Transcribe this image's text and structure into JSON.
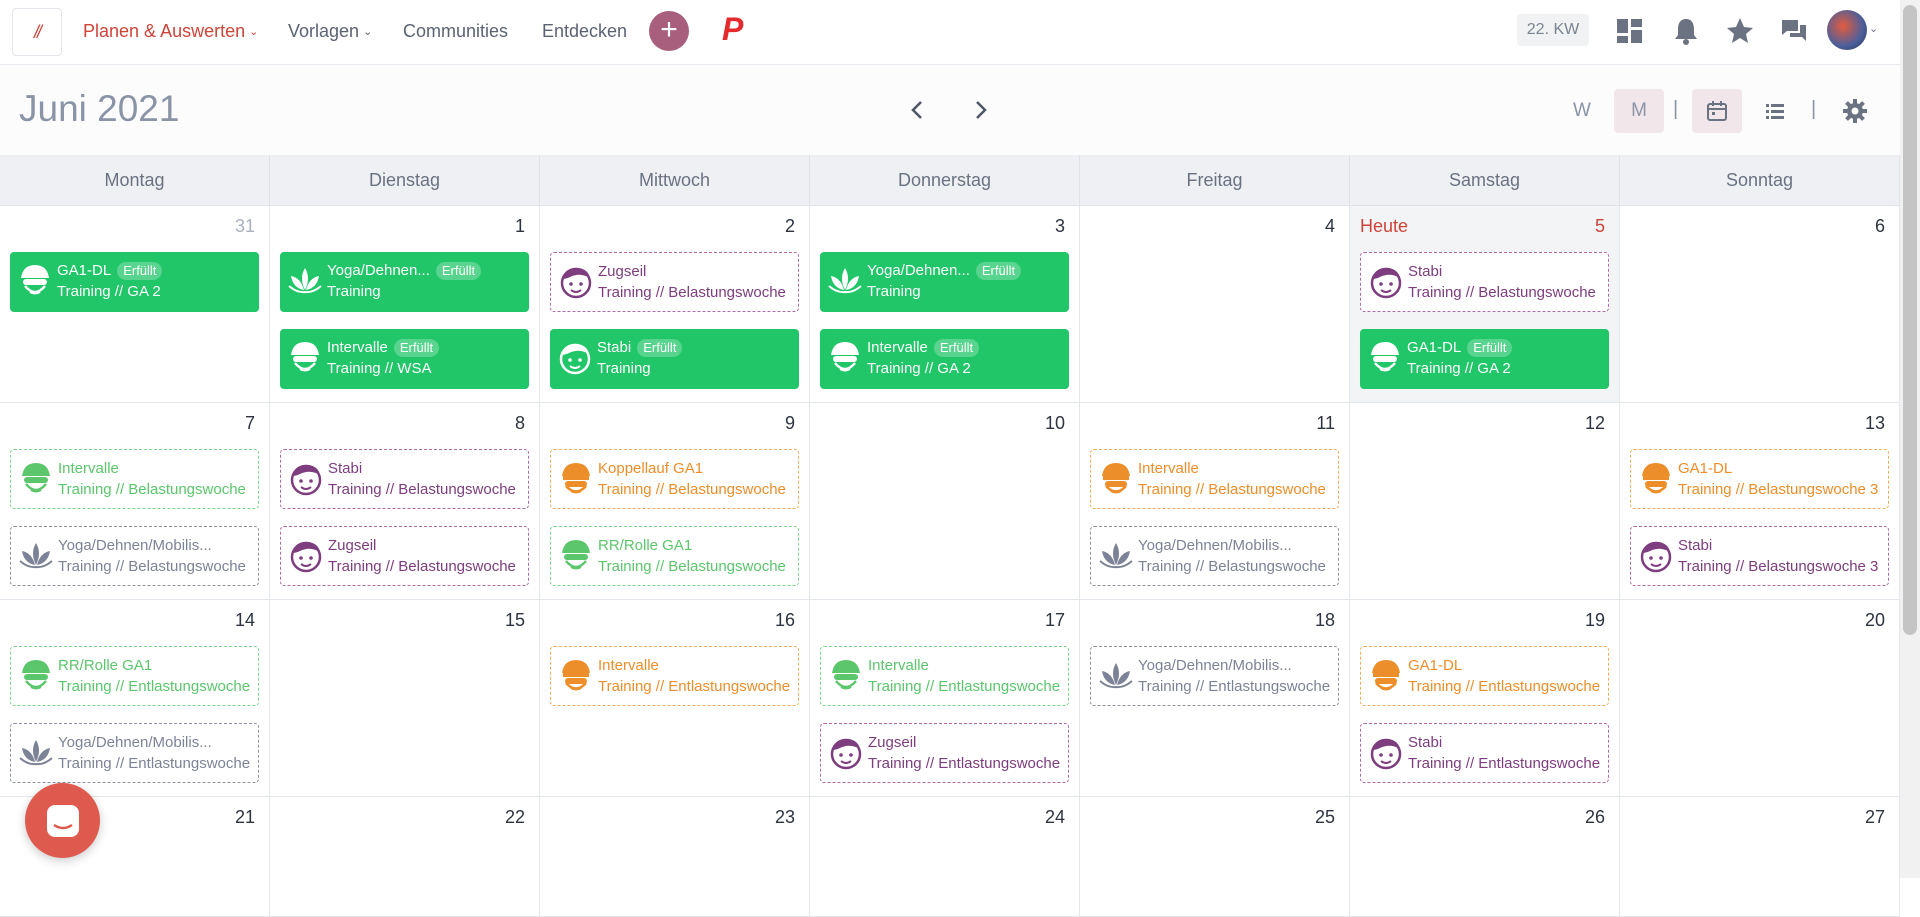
{
  "topbar": {
    "logo": "//",
    "nav": [
      {
        "label": "Planen & Auswerten",
        "caret": "⌄",
        "active": true
      },
      {
        "label": "Vorlagen",
        "caret": "⌄"
      },
      {
        "label": "Communities"
      },
      {
        "label": "Entdecken"
      }
    ],
    "plus": "+",
    "p_logo": "P",
    "week_badge": "22. KW"
  },
  "header": {
    "month": "Juni 2021",
    "view_w": "W",
    "view_m": "M",
    "sep": "|"
  },
  "calendar": {
    "weekdays": [
      "Montag",
      "Dienstag",
      "Mittwoch",
      "Donnerstag",
      "Freitag",
      "Samstag",
      "Sonntag"
    ],
    "today_label": "Heute",
    "days": [
      [
        "31",
        "1",
        "2",
        "3",
        "4",
        "5",
        "6"
      ],
      [
        "7",
        "8",
        "9",
        "10",
        "11",
        "12",
        "13"
      ],
      [
        "14",
        "15",
        "16",
        "17",
        "18",
        "19",
        "20"
      ],
      [
        "21",
        "22",
        "23",
        "24",
        "25",
        "26",
        "27"
      ]
    ],
    "events": [
      {
        "row": 0,
        "col": 0,
        "slot": 0,
        "style": "done",
        "icon": "helmet",
        "title": "GA1-DL",
        "badge": "Erfüllt",
        "sub": "Training // GA 2"
      },
      {
        "row": 0,
        "col": 1,
        "slot": 0,
        "style": "done",
        "icon": "lotus",
        "title": "Yoga/Dehnen...",
        "badge": "Erfüllt",
        "sub": "Training"
      },
      {
        "row": 0,
        "col": 1,
        "slot": 1,
        "style": "done",
        "icon": "helmet",
        "title": "Intervalle",
        "badge": "Erfüllt",
        "sub": "Training // WSA"
      },
      {
        "row": 0,
        "col": 2,
        "slot": 0,
        "style": "purple",
        "icon": "face",
        "title": "Zugseil",
        "sub": "Training // Belastungswoche"
      },
      {
        "row": 0,
        "col": 2,
        "slot": 1,
        "style": "done",
        "icon": "face",
        "title": "Stabi",
        "badge": "Erfüllt",
        "sub": "Training"
      },
      {
        "row": 0,
        "col": 3,
        "slot": 0,
        "style": "done",
        "icon": "lotus",
        "title": "Yoga/Dehnen...",
        "badge": "Erfüllt",
        "sub": "Training"
      },
      {
        "row": 0,
        "col": 3,
        "slot": 1,
        "style": "done",
        "icon": "helmet",
        "title": "Intervalle",
        "badge": "Erfüllt",
        "sub": "Training // GA 2"
      },
      {
        "row": 0,
        "col": 5,
        "slot": 0,
        "style": "purple",
        "icon": "face",
        "title": "Stabi",
        "sub": "Training // Belastungswoche"
      },
      {
        "row": 0,
        "col": 5,
        "slot": 1,
        "style": "done",
        "icon": "helmet",
        "title": "GA1-DL",
        "badge": "Erfüllt",
        "sub": "Training // GA 2"
      },
      {
        "row": 1,
        "col": 0,
        "slot": 0,
        "style": "green",
        "icon": "helmet",
        "title": "Intervalle",
        "sub": "Training // Belastungswoche"
      },
      {
        "row": 1,
        "col": 0,
        "slot": 1,
        "style": "grey",
        "icon": "lotus",
        "title": "Yoga/Dehnen/Mobilis...",
        "sub": "Training // Belastungswoche"
      },
      {
        "row": 1,
        "col": 1,
        "slot": 0,
        "style": "purple",
        "icon": "face",
        "title": "Stabi",
        "sub": "Training // Belastungswoche"
      },
      {
        "row": 1,
        "col": 1,
        "slot": 1,
        "style": "purple",
        "icon": "face",
        "title": "Zugseil",
        "sub": "Training // Belastungswoche"
      },
      {
        "row": 1,
        "col": 2,
        "slot": 0,
        "style": "orange",
        "icon": "runner",
        "title": "Koppellauf GA1",
        "sub": "Training // Belastungswoche"
      },
      {
        "row": 1,
        "col": 2,
        "slot": 1,
        "style": "green",
        "icon": "helmet",
        "title": "RR/Rolle GA1",
        "sub": "Training // Belastungswoche"
      },
      {
        "row": 1,
        "col": 4,
        "slot": 0,
        "style": "orange",
        "icon": "runner",
        "title": "Intervalle",
        "sub": "Training // Belastungswoche"
      },
      {
        "row": 1,
        "col": 4,
        "slot": 1,
        "style": "grey",
        "icon": "lotus",
        "title": "Yoga/Dehnen/Mobilis...",
        "sub": "Training // Belastungswoche"
      },
      {
        "row": 1,
        "col": 6,
        "slot": 0,
        "style": "orange",
        "icon": "runner",
        "title": "GA1-DL",
        "sub": "Training // Belastungswoche 3"
      },
      {
        "row": 1,
        "col": 6,
        "slot": 1,
        "style": "purple",
        "icon": "face",
        "title": "Stabi",
        "sub": "Training // Belastungswoche 3"
      },
      {
        "row": 2,
        "col": 0,
        "slot": 0,
        "style": "green",
        "icon": "helmet",
        "title": "RR/Rolle GA1",
        "sub": "Training // Entlastungswoche"
      },
      {
        "row": 2,
        "col": 0,
        "slot": 1,
        "style": "grey",
        "icon": "lotus",
        "title": "Yoga/Dehnen/Mobilis...",
        "sub": "Training // Entlastungswoche"
      },
      {
        "row": 2,
        "col": 2,
        "slot": 0,
        "style": "orange",
        "icon": "runner",
        "title": "Intervalle",
        "sub": "Training // Entlastungswoche"
      },
      {
        "row": 2,
        "col": 3,
        "slot": 0,
        "style": "green",
        "icon": "helmet",
        "title": "Intervalle",
        "sub": "Training // Entlastungswoche"
      },
      {
        "row": 2,
        "col": 3,
        "slot": 1,
        "style": "purple",
        "icon": "face",
        "title": "Zugseil",
        "sub": "Training // Entlastungswoche"
      },
      {
        "row": 2,
        "col": 4,
        "slot": 0,
        "style": "grey",
        "icon": "lotus",
        "title": "Yoga/Dehnen/Mobilis...",
        "sub": "Training // Entlastungswoche"
      },
      {
        "row": 2,
        "col": 5,
        "slot": 0,
        "style": "orange",
        "icon": "runner",
        "title": "GA1-DL",
        "sub": "Training // Entlastungswoche"
      },
      {
        "row": 2,
        "col": 5,
        "slot": 1,
        "style": "purple",
        "icon": "face",
        "title": "Stabi",
        "sub": "Training // Entlastungswoche"
      }
    ]
  },
  "icons": {
    "helmet": "cyclist-helmet-icon",
    "lotus": "lotus-icon",
    "face": "athlete-face-icon",
    "runner": "runner-cap-icon"
  },
  "colors": {
    "accent": "#cf4438",
    "done": "#21c669",
    "purple": "#7d3d7e",
    "green": "#5cc66c",
    "orange": "#ec8e2a",
    "grey": "#7d8396"
  }
}
